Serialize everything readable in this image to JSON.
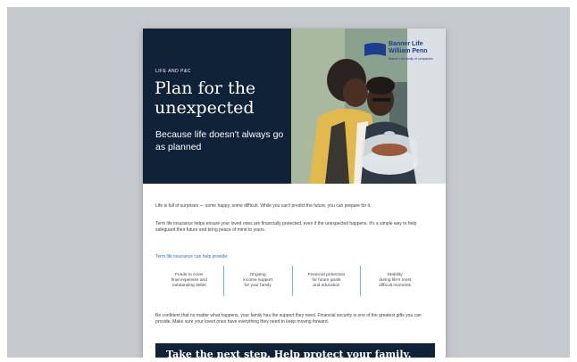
{
  "document": {
    "eyebrow": "LIFE AND P&C",
    "headline": "Plan for the unexpected",
    "subhead": "Because life doesn't always go as planned",
    "brand": {
      "name_line1": "Banner Life",
      "name_line2": "William Penn",
      "tagline": "Banner Life family of companies"
    },
    "paragraph_1": "Life is full of surprises — some happy, some difficult. While you can't predict the future, you can prepare for it.",
    "paragraph_2": "Term life insurance helps ensure your loved ones are financially protected, even if the unexpected happens. It's a simple way to help safeguard their future and bring peace of mind to yours.",
    "callout": "Term life insurance can help provide:",
    "benefits": [
      "Funds to cover\nfinal expenses and\noutstanding debts",
      "Ongoing\nincome support\nfor your family",
      "Financial protection\nfor future goals\nand education",
      "Stability\nduring life's most\ndifficult moments"
    ],
    "paragraph_3": "Be confident that no matter what happens, your family has the support they need. Financial security is one of the greatest gifts you can provide. Make sure your loved ones have everything they need to keep moving forward.",
    "banner": "Take the next step. Help protect your family."
  },
  "colors": {
    "navy": "#0f2238",
    "brand_blue": "#1d3d8f",
    "link_blue": "#2a6fc2",
    "background": "#c5c8cd"
  }
}
